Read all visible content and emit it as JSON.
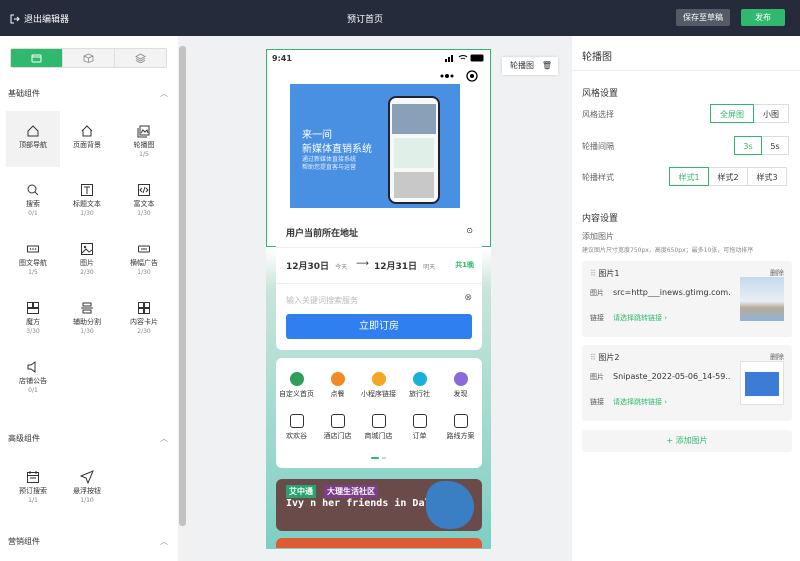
{
  "topbar": {
    "exit": "退出编辑器",
    "title": "预订首页",
    "save": "保存至草稿",
    "publish": "发布"
  },
  "left": {
    "sections": [
      "基础组件",
      "高级组件",
      "营销组件"
    ],
    "basic": [
      {
        "label": "顶部导航",
        "count": "",
        "icon": "home-icon"
      },
      {
        "label": "页面背景",
        "count": "",
        "icon": "home-outline-icon"
      },
      {
        "label": "轮播图",
        "count": "1/5",
        "icon": "image-stack-icon"
      },
      {
        "label": "搜索",
        "count": "0/1",
        "icon": "search-icon"
      },
      {
        "label": "标题文本",
        "count": "1/30",
        "icon": "text-icon"
      },
      {
        "label": "富文本",
        "count": "1/30",
        "icon": "code-icon"
      },
      {
        "label": "图文导航",
        "count": "1/5",
        "icon": "dots-icon"
      },
      {
        "label": "图片",
        "count": "2/30",
        "icon": "picture-icon"
      },
      {
        "label": "横幅广告",
        "count": "1/30",
        "icon": "banner-icon"
      },
      {
        "label": "魔方",
        "count": "3/30",
        "icon": "cube-icon"
      },
      {
        "label": "辅助分割",
        "count": "1/30",
        "icon": "divider-icon"
      },
      {
        "label": "内容卡片",
        "count": "2/30",
        "icon": "cards-icon"
      },
      {
        "label": "店铺公告",
        "count": "0/1",
        "icon": "speaker-icon"
      }
    ],
    "advanced": [
      {
        "label": "预订搜索",
        "count": "1/1",
        "icon": "calendar-icon"
      },
      {
        "label": "悬浮按钮",
        "count": "1/10",
        "icon": "send-icon"
      }
    ]
  },
  "phone": {
    "time": "9:41",
    "banner": {
      "line1": "来一间",
      "line2": "新媒体直销系统",
      "line3": "通过新媒体直接系统 帮助您提直客与运营"
    },
    "card": {
      "address": "用户当前所在地址",
      "checkin": "12月30日",
      "checkin_tag": "今天",
      "checkout": "12月31日",
      "checkout_tag": "明天",
      "nights": "共1晚",
      "keyword_ph": "输入关键词搜索服务",
      "book": "立即订房"
    },
    "nav": [
      {
        "label": "自定义首页",
        "color": "#2e9e5a"
      },
      {
        "label": "点餐",
        "color": "#f08a24"
      },
      {
        "label": "小程序链接",
        "color": "#f5a623"
      },
      {
        "label": "旅行社",
        "color": "#1ab0d8"
      },
      {
        "label": "发现",
        "color": "#8a6ad8"
      },
      {
        "label": "欢欢谷",
        "color": "#333"
      },
      {
        "label": "酒店门店",
        "color": "#333"
      },
      {
        "label": "商城门店",
        "color": "#333"
      },
      {
        "label": "订单",
        "color": "#333"
      },
      {
        "label": "路线方案",
        "color": "#333"
      }
    ],
    "promo": {
      "tag1": "艾中通",
      "tag2": "大理生活社区",
      "title": "Ivy n her friends in Dali"
    },
    "tag": "轮播图"
  },
  "right": {
    "title": "轮播图",
    "style_h": "风格设置",
    "style_label": "风格选择",
    "style_opts": [
      "全屏图",
      "小图"
    ],
    "interval_label": "轮播间隔",
    "interval_opts": [
      "3s",
      "5s"
    ],
    "carousel_label": "轮播样式",
    "carousel_opts": [
      "样式1",
      "样式2",
      "样式3"
    ],
    "content_h": "内容设置",
    "add_label": "添加图片",
    "hint": "建议图片尺寸宽度750px，高度650px；最多10张，可拖动排序",
    "images": [
      {
        "name": "图片1",
        "src": "src=http___inews.gtimg.com...",
        "link": "请选择跳转链接"
      },
      {
        "name": "图片2",
        "src": "Snipaste_2022-05-06_14-59...",
        "link": "请选择跳转链接"
      }
    ],
    "k_img": "图片",
    "k_link": "链接",
    "del": "删除",
    "add_btn": "+ 添加图片"
  }
}
